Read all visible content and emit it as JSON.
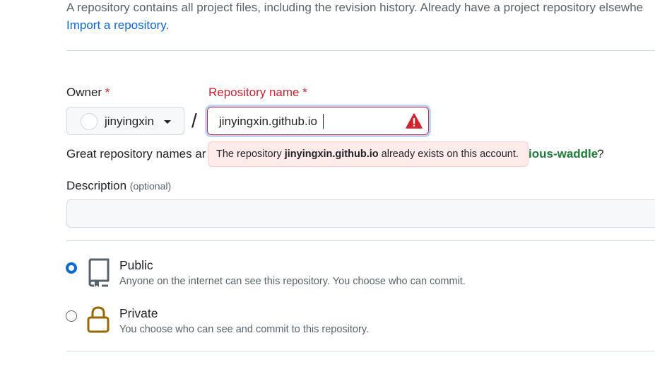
{
  "intro": {
    "text": "A repository contains all project files, including the revision history. Already have a project repository elsewhe",
    "import_link": "Import a repository."
  },
  "owner": {
    "label": "Owner",
    "required_mark": "*",
    "selected": "jinyingxin",
    "icon": "chevron-down-icon"
  },
  "repository": {
    "label": "Repository name",
    "required_mark": "*",
    "separator": "/",
    "value": "jinyingxin.github.io",
    "status_icon": "alert-icon",
    "error": {
      "prefix": "The repository ",
      "name": "jinyingxin.github.io",
      "suffix": " already exists on this account."
    }
  },
  "hint": {
    "text": "Great repository names ar",
    "suggestion": "ious-waddle",
    "end": "?"
  },
  "description": {
    "label": "Description",
    "optional": "(optional)",
    "value": ""
  },
  "visibility": [
    {
      "title": "Public",
      "description": "Anyone on the internet can see this repository. You choose who can commit.",
      "selected": true,
      "icon": "repo-icon"
    },
    {
      "title": "Private",
      "description": "You choose who can see and commit to this repository.",
      "selected": false,
      "icon": "lock-icon"
    }
  ],
  "colors": {
    "danger": "#cf222e",
    "link": "#0969da",
    "success": "#1a7f37",
    "warning_icon": "#d1242f",
    "private_icon": "#9a6700"
  }
}
